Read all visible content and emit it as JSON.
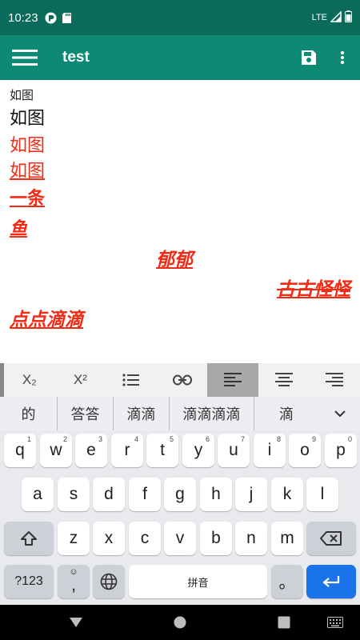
{
  "status_bar": {
    "time": "10:23",
    "network": "LTE"
  },
  "app_bar": {
    "title": "test"
  },
  "editor": {
    "lines": [
      "如图",
      "如图",
      "如图",
      "如图",
      "一条",
      "鱼",
      "郁郁",
      "古古怪怪",
      "点点滴滴"
    ]
  },
  "toolbar": {
    "subscript": "X₂",
    "superscript": "X²"
  },
  "suggestions": [
    "的",
    "答答",
    "滴滴",
    "滴滴滴滴",
    "滴"
  ],
  "keyboard": {
    "row1": [
      {
        "key": "q",
        "hint": "1"
      },
      {
        "key": "w",
        "hint": "2"
      },
      {
        "key": "e",
        "hint": "3"
      },
      {
        "key": "r",
        "hint": "4"
      },
      {
        "key": "t",
        "hint": "5"
      },
      {
        "key": "y",
        "hint": "6"
      },
      {
        "key": "u",
        "hint": "7"
      },
      {
        "key": "i",
        "hint": "8"
      },
      {
        "key": "o",
        "hint": "9"
      },
      {
        "key": "p",
        "hint": "0"
      }
    ],
    "row2": [
      "a",
      "s",
      "d",
      "f",
      "g",
      "h",
      "j",
      "k",
      "l"
    ],
    "row3": [
      "z",
      "x",
      "c",
      "v",
      "b",
      "n",
      "m"
    ],
    "symbols_label": "?123",
    "comma": ",",
    "space_label": "拼音",
    "period": "。"
  },
  "colors": {
    "status_bar": "#0b6b5a",
    "app_bar": "#0e8a74",
    "text_red": "#f42a14",
    "enter_key": "#1a73e8"
  }
}
